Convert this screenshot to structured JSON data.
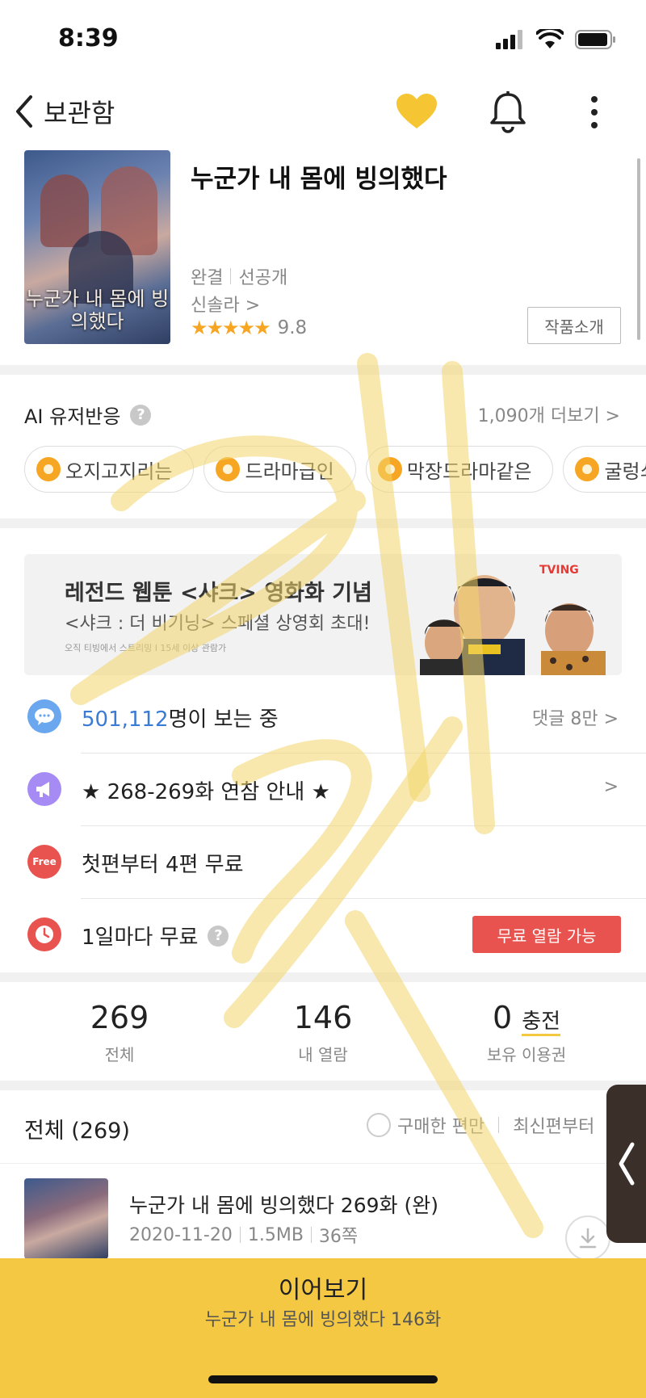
{
  "status": {
    "time": "8:39"
  },
  "nav": {
    "back_label": "보관함"
  },
  "work": {
    "cover_title": "누군가 내 몸에 빙의했다",
    "title": "누군가 내 몸에 빙의했다",
    "status": "완결",
    "access": "선공개",
    "author": "신솔라 >",
    "stars": "★★★★★",
    "rating": "9.8",
    "intro_button": "작품소개"
  },
  "ai": {
    "title": "AI 유저반응",
    "help": "?",
    "more": "1,090개 더보기 >",
    "chips": [
      "오지고지리는",
      "드라마급인",
      "막장드라마같은",
      "굴렁쇠"
    ]
  },
  "banner": {
    "title": "레전드 웹툰 <샤크> 영화화 기념",
    "subtitle": "<샤크 : 더 비기닝> 스페셜 상영회 초대!",
    "note": "오직 티빙에서 스트리밍 I 15세 이상 관람가",
    "brand": "TVING"
  },
  "rows": {
    "viewers_count": "501,112",
    "viewers_suffix": "명이 보는 중",
    "comments": "댓글 8만 >",
    "notice": "★ 268-269화 연참 안내 ★",
    "notice_arrow": ">",
    "free_badge": "Free",
    "free_text": "첫편부터 4편 무료",
    "daily_text": "1일마다 무료",
    "daily_help": "?",
    "daily_button": "무료 열람 가능"
  },
  "stats": {
    "total_num": "269",
    "total_label": "전체",
    "read_num": "146",
    "read_label": "내 열람",
    "ticket_num": "0",
    "ticket_charge": "충전",
    "ticket_label": "보유 이용권"
  },
  "list": {
    "header": "전체 (269)",
    "filter_purchased": "구매한 편만",
    "filter_sort": "최신편부터"
  },
  "episode": {
    "title": "누군가 내 몸에 빙의했다 269화 (완)",
    "date": "2020-11-20",
    "size": "1.5MB",
    "pages": "36쪽"
  },
  "continue": {
    "title": "이어보기",
    "subtitle": "누군가 내 몸에 빙의했다 146화"
  },
  "colors": {
    "accent_yellow": "#f4c842",
    "heart": "#f5c533",
    "star": "#f6a623",
    "link_blue": "#3a7bd5",
    "free_red": "#e8534f"
  }
}
